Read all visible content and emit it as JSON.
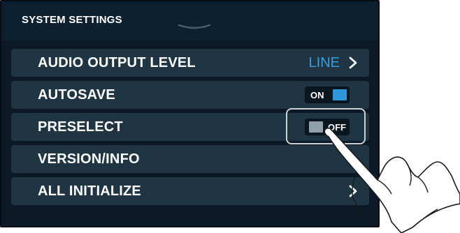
{
  "header": {
    "title": "SYSTEM SETTINGS"
  },
  "rows": [
    {
      "label": "AUDIO OUTPUT LEVEL",
      "value": "LINE",
      "has_chevron": true
    },
    {
      "label": "AUTOSAVE",
      "toggle": "ON"
    },
    {
      "label": "PRESELECT",
      "toggle": "OFF"
    },
    {
      "label": "VERSION/INFO"
    },
    {
      "label": "ALL INITIALIZE",
      "has_chevron": true
    }
  ],
  "colors": {
    "row_bg": "#1f3544",
    "value_blue": "#3c9cd6",
    "toggle_on_knob": "#2f98d8",
    "toggle_off_knob": "#8fa0aa",
    "highlight_border": "#d0d0d0"
  },
  "icons": {
    "grab_handle": "chevron-down-handle-icon",
    "chevron": "chevron-right-icon",
    "hand": "pointing-hand-icon"
  }
}
